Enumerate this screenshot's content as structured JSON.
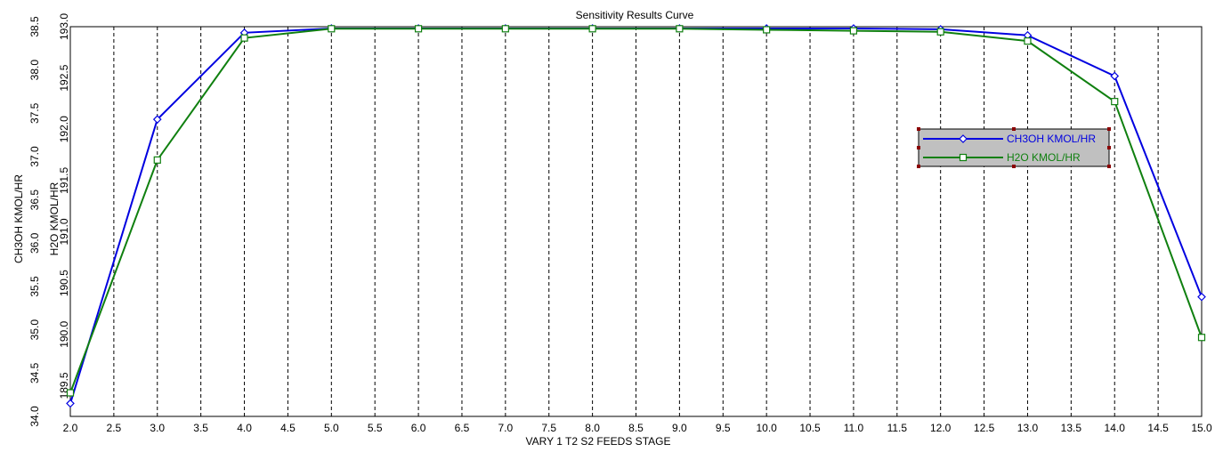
{
  "chart_data": {
    "type": "line",
    "title": "Sensitivity Results Curve",
    "xlabel": "VARY   1 T2 S2 FEEDS STAGE",
    "ylabel_left": "CH3OH KMOL/HR",
    "ylabel_right": "H2O KMOL/HR",
    "xlim": [
      2.0,
      15.0
    ],
    "ylim_left": [
      34.0,
      38.5
    ],
    "ylim_right": [
      189.2,
      193.0
    ],
    "x_ticks": [
      "2.0",
      "2.5",
      "3.0",
      "3.5",
      "4.0",
      "4.5",
      "5.0",
      "5.5",
      "6.0",
      "6.5",
      "7.0",
      "7.5",
      "8.0",
      "8.5",
      "9.0",
      "9.5",
      "10.0",
      "10.5",
      "11.0",
      "11.5",
      "12.0",
      "12.5",
      "13.0",
      "13.5",
      "14.0",
      "14.5",
      "15.0"
    ],
    "y_ticks_left": [
      "34.0",
      "34.5",
      "35.0",
      "35.5",
      "36.0",
      "36.5",
      "37.0",
      "37.5",
      "38.0",
      "38.5"
    ],
    "y_ticks_right": [
      "189.5",
      "190.0",
      "190.5",
      "191.0",
      "191.5",
      "192.0",
      "192.5",
      "193.0"
    ],
    "grid": "vertical dashed",
    "legend_position": "right",
    "x": [
      2,
      3,
      4,
      5,
      6,
      7,
      8,
      9,
      10,
      11,
      12,
      13,
      14,
      15
    ],
    "series": [
      {
        "name": "CH3OH KMOL/HR",
        "axis": "left",
        "color": "#0000e0",
        "marker": "diamond",
        "values": [
          34.15,
          37.43,
          38.43,
          38.48,
          38.48,
          38.48,
          38.48,
          38.48,
          38.48,
          38.48,
          38.47,
          38.4,
          37.93,
          35.38
        ]
      },
      {
        "name": "H2O KMOL/HR",
        "axis": "right",
        "color": "#108010",
        "marker": "square",
        "values": [
          189.43,
          191.7,
          192.89,
          192.98,
          192.98,
          192.98,
          192.98,
          192.98,
          192.97,
          192.96,
          192.95,
          192.86,
          192.27,
          189.97
        ]
      }
    ]
  }
}
